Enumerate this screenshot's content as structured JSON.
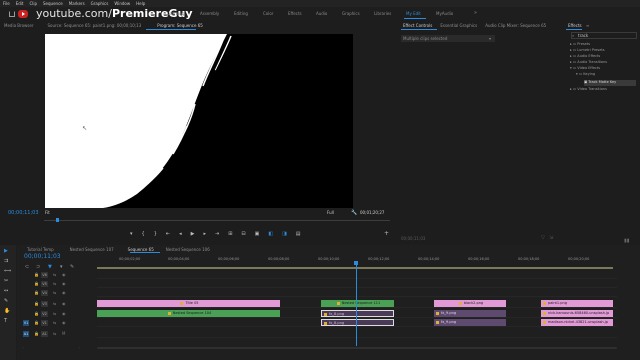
{
  "menu": [
    "File",
    "Edit",
    "Clip",
    "Sequence",
    "Markers",
    "Graphics",
    "Window",
    "Help"
  ],
  "branding": {
    "url_prefix": "youtube.com/",
    "url_name": "PremiereGuy"
  },
  "workspaces": [
    "Learning",
    "Assembly",
    "Editing",
    "Color",
    "Effects",
    "Audio",
    "Graphics",
    "Libraries",
    "My Edit",
    "MyAudio"
  ],
  "active_workspace": "My Edit",
  "source_tabs": {
    "media_browser": "Media Browser",
    "source": "Source: Sequence 65: paint1.png: 00;00;10;13",
    "program": "Program: Sequence 65"
  },
  "monitor": {
    "timecode_left": "00;00;11;03",
    "fit": "Fit",
    "quality": "Full",
    "timecode_right": "00;01;20;27",
    "playhead_fraction": 0.035
  },
  "transport_icons": [
    "mark-in",
    "mark-out",
    "go-to-in",
    "step-back",
    "play",
    "step-forward",
    "go-to-out",
    "insert",
    "overwrite",
    "export-frame",
    "button-a",
    "button-b",
    "comparison"
  ],
  "effect_controls": {
    "tabs": [
      "Effect Controls",
      "Essential Graphics",
      "Audio Clip Mixer: Sequence 65"
    ],
    "dropdown": "Multiple clips selected",
    "timecode": "00;00;11;03"
  },
  "effects": {
    "title": "Effects",
    "search": "track",
    "items": [
      "Presets",
      "Lumetri Presets",
      "Audio Effects",
      "Audio Transitions",
      "Video Effects",
      "Keying",
      "Track Matte Key",
      "Video Transitions"
    ],
    "selected": "Track Matte Key"
  },
  "timeline": {
    "tabs": [
      "Tutorial Temp",
      "Nested Sequence 107",
      "Sequence 65",
      "Nested Sequence 106"
    ],
    "active_tab": "Sequence 65",
    "timecode": "00;00;11;03",
    "ruler": [
      "00;00;02;00",
      "00;00;04;00",
      "00;00;06;00",
      "00;00;08;00",
      "00;00;10;00",
      "00;00;12;00",
      "00;00;14;00",
      "00;00;16;00",
      "00;00;18;00",
      "00;00;20;00"
    ],
    "tracks": [
      "V6",
      "V5",
      "V4",
      "V3",
      "V2",
      "V1",
      "A1"
    ],
    "target_labels": {
      "V1": "V1",
      "A1": "A1"
    },
    "clips": {
      "title": "Title 05",
      "nested_top": "Nested Sequence 111",
      "black": "black2.png",
      "paint": "paint1.png",
      "nested_bottom": "Nested Sequence 104",
      "purple1": "fx_8.png",
      "purple2": "fx_9.png",
      "purple3": "fx_8.png",
      "purple4": "fx_9.png",
      "nick": "nick-karvounis-658460-unsplash.jp",
      "madison": "madison-nickel-43821-unsplash.jp"
    }
  },
  "colors": {
    "accent": "#2b8cdd",
    "clip_pink": "#e29ad6",
    "clip_green": "#4aa054",
    "clip_purple": "#4a3a57"
  }
}
